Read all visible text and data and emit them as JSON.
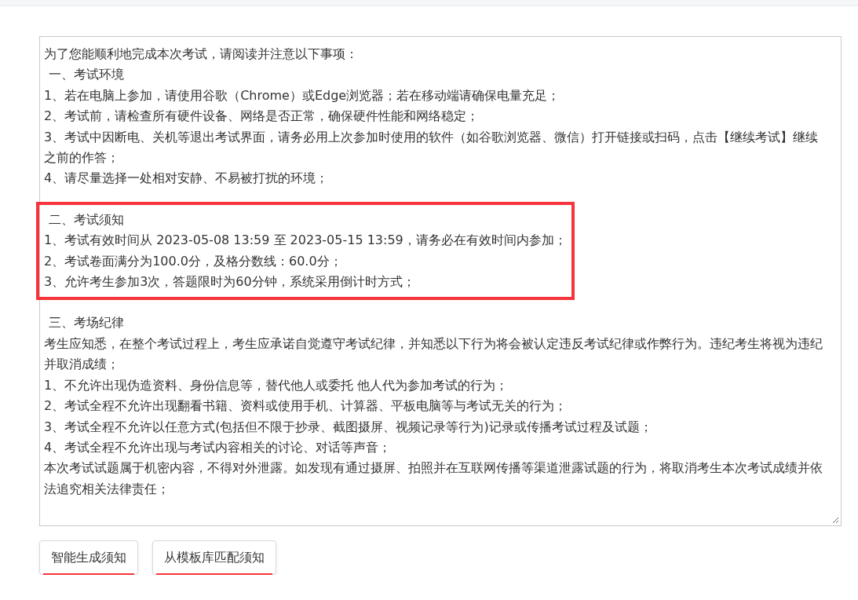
{
  "notice": {
    "intro": "为了您能顺利地完成本次考试，请阅读并注意以下事项：",
    "sections": [
      {
        "heading": "一、考试环境",
        "highlighted": false,
        "lines": [
          "1、若在电脑上参加，请使用谷歌（Chrome）或Edge浏览器；若在移动端请确保电量充足；",
          "2、考试前，请检查所有硬件设备、网络是否正常，确保硬件性能和网络稳定；",
          "3、考试中因断电、关机等退出考试界面，请务必用上次参加时使用的软件（如谷歌浏览器、微信）打开链接或扫码，点击【继续考试】继续之前的作答；",
          "4、请尽量选择一处相对安静、不易被打扰的环境；"
        ]
      },
      {
        "heading": "二、考试须知",
        "highlighted": true,
        "lines": [
          "1、考试有效时间从 2023-05-08 13:59 至 2023-05-15 13:59，请务必在有效时间内参加；",
          "2、考试卷面满分为100.0分，及格分数线：60.0分；",
          "3、允许考生参加3次，答题限时为60分钟，系统采用倒计时方式；"
        ]
      },
      {
        "heading": "三、考场纪律",
        "highlighted": false,
        "lines": [
          "考生应知悉，在整个考试过程上，考生应承诺自觉遵守考试纪律，并知悉以下行为将会被认定违反考试纪律或作弊行为。违纪考生将视为违纪并取消成绩；",
          "1、不允许出现伪造资料、身份信息等，替代他人或委托 他人代为参加考试的行为；",
          "2、考试全程不允许出现翻看书籍、资料或使用手机、计算器、平板电脑等与考试无关的行为；",
          "3、考试全程不允许以任意方式(包括但不限于抄录、截图摄屏、视频记录等行为)记录或传播考试过程及试题；",
          "4、考试全程不允许出现与考试内容相关的讨论、对话等声音；",
          "本次考试试题属于机密内容，不得对外泄露。如发现有通过摄屏、拍照并在互联网传播等渠道泄露试题的行为，将取消考生本次考试成绩并依法追究相关法律责任；"
        ]
      }
    ]
  },
  "buttons": [
    {
      "label": "智能生成须知",
      "underlined": true
    },
    {
      "label": "从模板库匹配须知",
      "underlined": true
    }
  ]
}
